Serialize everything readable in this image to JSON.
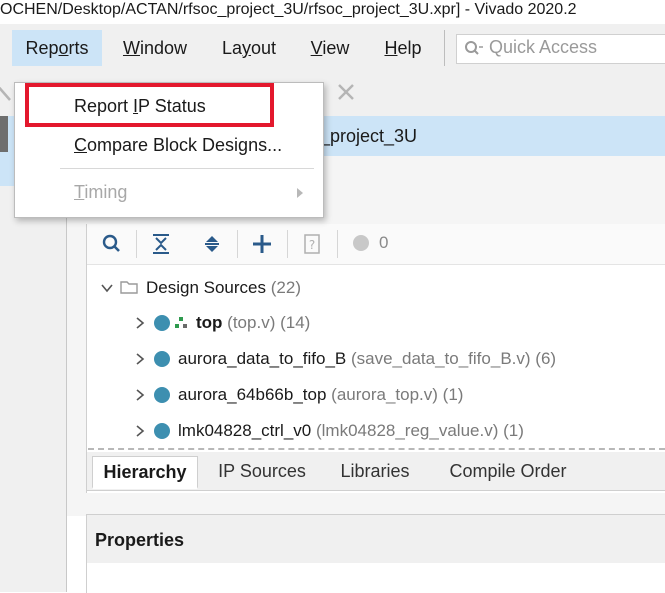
{
  "window": {
    "title": "OCHEN/Desktop/ACTAN/rfsoc_project_3U/rfsoc_project_3U.xpr] - Vivado 2020.2"
  },
  "menubar": {
    "items": [
      {
        "label": "Reports"
      },
      {
        "label": "Window"
      },
      {
        "label": "Layout"
      },
      {
        "label": "View"
      },
      {
        "label": "Help"
      }
    ],
    "quick_access_placeholder": "Quick Access"
  },
  "dropdown": {
    "items": [
      {
        "label": "Report IP Status",
        "enabled": true
      },
      {
        "label": "Compare Block Designs...",
        "enabled": true
      },
      {
        "label": "Timing",
        "enabled": false,
        "has_submenu": true
      }
    ]
  },
  "project": {
    "title_fragment": "_project_3U"
  },
  "sources": {
    "toolbar_count": "0",
    "tree": {
      "root": {
        "label": "Design Sources",
        "count": "(22)"
      },
      "children": [
        {
          "name": "top",
          "detail": "(top.v)",
          "count": "(14)"
        },
        {
          "name": "aurora_data_to_fifo_B",
          "detail": "(save_data_to_fifo_B.v)",
          "count": "(6)"
        },
        {
          "name": "aurora_64b66b_top",
          "detail": "(aurora_top.v)",
          "count": "(1)"
        },
        {
          "name": "lmk04828_ctrl_v0",
          "detail": "(lmk04828_reg_value.v)",
          "count": "(1)"
        }
      ]
    },
    "tabs": [
      {
        "label": "Hierarchy"
      },
      {
        "label": "IP Sources"
      },
      {
        "label": "Libraries"
      },
      {
        "label": "Compile Order"
      }
    ]
  },
  "properties": {
    "title": "Properties"
  },
  "colors": {
    "highlight_border": "#e3182d",
    "selection_blue": "#cce4f7",
    "status_dot": "#3d8fb0"
  }
}
